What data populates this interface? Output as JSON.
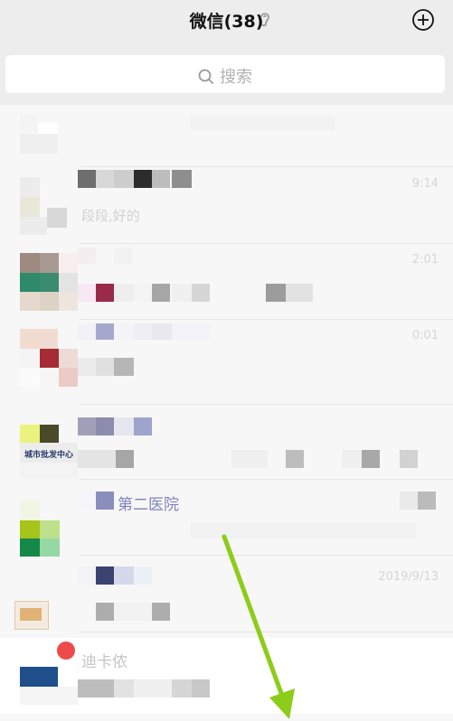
{
  "header": {
    "title": "微信(38)",
    "icons": [
      "ear-icon",
      "plus-icon"
    ]
  },
  "search": {
    "placeholder": "搜索",
    "icon": "search-icon"
  },
  "chats": [
    {
      "name": "",
      "preview": "",
      "time": ""
    },
    {
      "name": "",
      "preview": "段段,好的",
      "time": "9:14"
    },
    {
      "name": "",
      "preview": "",
      "time": "2:01"
    },
    {
      "name": "",
      "preview": "",
      "time": "0:01"
    },
    {
      "name": "",
      "preview": "",
      "time": "",
      "avatar_text": "城市批发中心"
    },
    {
      "name": "第二医院",
      "preview": "",
      "time": ""
    },
    {
      "name": "",
      "preview": "",
      "time": "2019/9/13"
    },
    {
      "name": "迪卡侬",
      "preview": "",
      "time": ""
    }
  ],
  "colors": {
    "accent_arrow": "#8ccc1a",
    "badge": "#ee4a4a",
    "background": "#ededed"
  }
}
